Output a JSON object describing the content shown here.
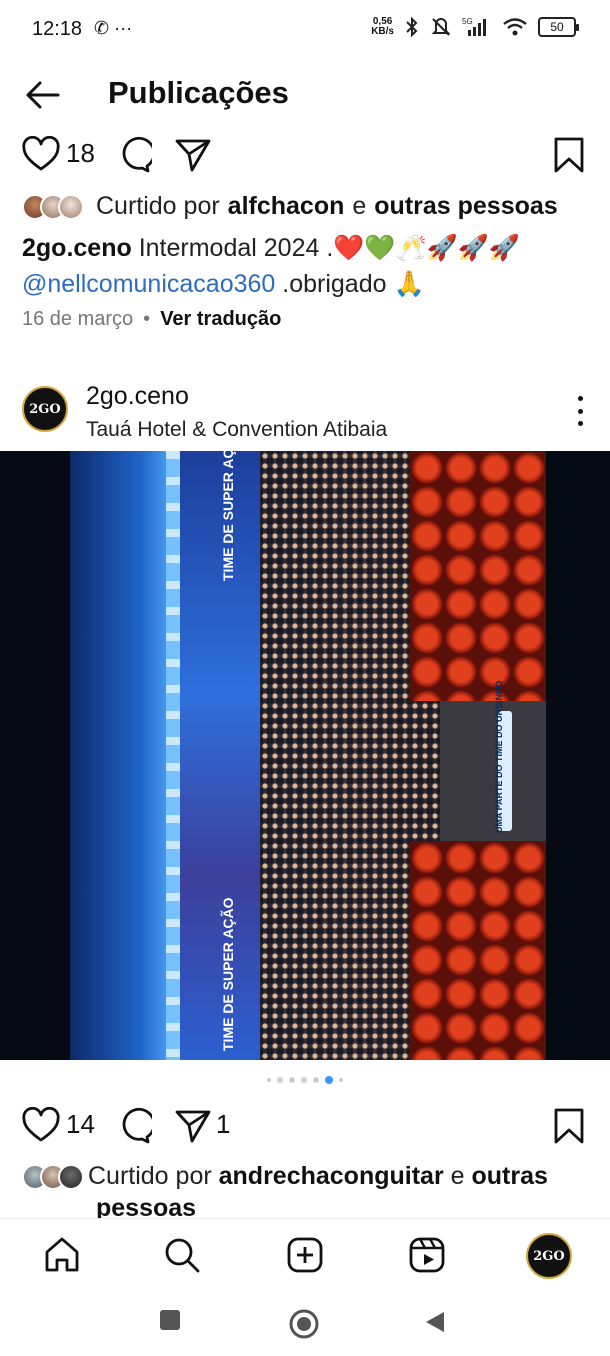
{
  "status_bar": {
    "time": "12:18",
    "left_icons": "✆ ···",
    "speed_value": "0,56",
    "speed_unit": "KB/s",
    "signal_label": "5G",
    "battery": "50"
  },
  "header": {
    "title": "Publicações",
    "back_icon": "arrow-left-icon"
  },
  "post1": {
    "like_count": "18",
    "liked_by_prefix": "Curtido por",
    "liked_by_user": "alfchacon",
    "liked_by_and": "e",
    "liked_by_others": "outras pessoas",
    "caption_user": "2go.ceno",
    "caption_text": " Intermodal 2024 .❤️💚🥂🚀🚀🚀",
    "caption_mention": "@nellcomunicacao360",
    "caption_after_mention": " .obrigado 🙏",
    "date": "16 de março",
    "separator": "•",
    "translate": "Ver tradução"
  },
  "post2": {
    "username": "2go.ceno",
    "location": "Tauá Hotel & Convention Atibaia",
    "avatar_text": "2GO",
    "photo_texts": {
      "screen_top": "TIME DE SUPER AÇÃO",
      "screen_bottom": "TIME DE SUPER AÇÃO",
      "aisle_sign": "UMA PARTE DO TIME DO URSINHO"
    },
    "carousel": {
      "total": 7,
      "active_index": 5
    },
    "like_count": "14",
    "share_count": "1",
    "liked_by_prefix": "Curtido por",
    "liked_by_user": "andrechaconguitar",
    "liked_by_and": "e",
    "liked_by_others": "outras",
    "liked_by_wrap": "pessoas"
  },
  "bottom_nav": {
    "items": [
      "home-icon",
      "search-icon",
      "create-icon",
      "reels-icon",
      "profile-avatar"
    ],
    "profile_avatar_text": "2GO"
  },
  "system_nav": [
    "recents-button",
    "home-button",
    "back-button"
  ]
}
